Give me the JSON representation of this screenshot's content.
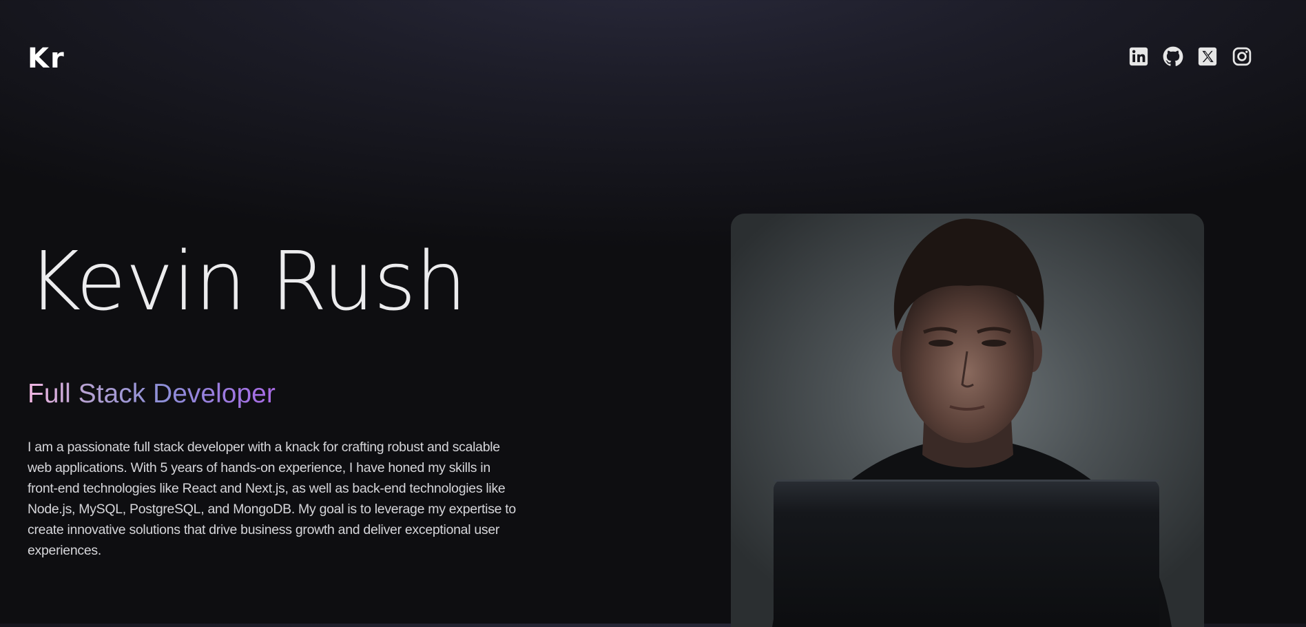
{
  "header": {
    "logo_text": "Kr",
    "social_links": [
      {
        "icon": "linkedin-icon"
      },
      {
        "icon": "github-icon"
      },
      {
        "icon": "x-twitter-icon"
      },
      {
        "icon": "instagram-icon"
      }
    ]
  },
  "hero": {
    "name": "Kevin Rush",
    "role": "Full Stack Developer",
    "bio": "I am a passionate full stack developer with a knack for crafting robust and scalable web applications. With 5 years of hands-on experience, I have honed my skills in front-end technologies like React and Next.js, as well as back-end technologies like Node.js, MySQL, PostgreSQL, and MongoDB. My goal is to leverage my expertise to create innovative solutions that drive business growth and deliver exceptional user experiences."
  },
  "colors": {
    "background": "#0e0e11",
    "header_glow": "#2a2a3c",
    "role_gradient": [
      "#f1b6e2",
      "#b3a1d2",
      "#8d8fd8",
      "#a96ae6"
    ],
    "text": "#d6d6da"
  }
}
